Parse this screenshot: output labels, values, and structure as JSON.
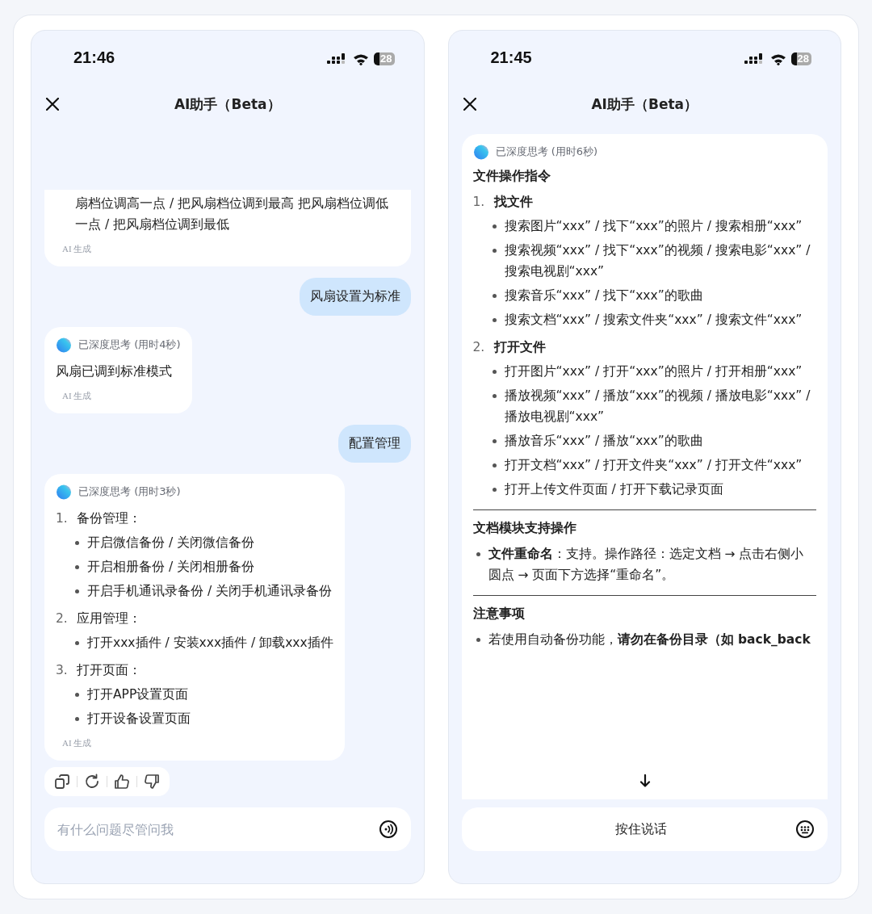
{
  "panels": [
    {
      "status": {
        "time": "21:46",
        "battery": "28"
      },
      "title": "AI助手（Beta）",
      "scrolled_to_end": true,
      "messages": [
        {
          "kind": "ai",
          "cut_top": true,
          "cut_bottom": false,
          "blocks": [
            {
              "kind": "continuation",
              "text": "扇档位调高一点 / 把风扇档位调到最高 把风扇档位调低一点 / 把风扇档位调到最低"
            }
          ],
          "footer": "AI 生成"
        },
        {
          "kind": "user",
          "text": "风扇设置为标准"
        },
        {
          "kind": "ai",
          "cut_top": false,
          "cut_bottom": false,
          "thinking": "已深度思考 (用时4秒)",
          "blocks": [
            {
              "kind": "paragraph",
              "text": "风扇已调到标准模式"
            }
          ],
          "footer": "AI 生成"
        },
        {
          "kind": "user",
          "text": "配置管理"
        },
        {
          "kind": "ai",
          "cut_top": false,
          "cut_bottom": false,
          "thinking": "已深度思考 (用时3秒)",
          "blocks": [
            {
              "kind": "ordered",
              "bold_titles": false,
              "items": [
                {
                  "number": "1.",
                  "title": "备份管理：",
                  "bullets": [
                    "开启微信备份 / 关闭微信备份",
                    "开启相册备份 / 关闭相册备份",
                    "开启手机通讯录备份 / 关闭手机通讯录备份"
                  ]
                },
                {
                  "number": "2.",
                  "title": "应用管理：",
                  "bullets": [
                    "打开xxx插件 / 安装xxx插件 / 卸载xxx插件"
                  ]
                },
                {
                  "number": "3.",
                  "title": "打开页面：",
                  "bullets": [
                    "打开APP设置页面",
                    "打开设备设置页面"
                  ]
                }
              ]
            }
          ],
          "footer": "AI 生成",
          "actions": true
        }
      ],
      "composer": {
        "kind": "text",
        "placeholder": "有什么问题尽管问我"
      },
      "scroll_down": false
    },
    {
      "status": {
        "time": "21:45",
        "battery": "28"
      },
      "title": "AI助手（Beta）",
      "scrolled_to_end": false,
      "messages": [
        {
          "kind": "ai",
          "cut_top": false,
          "cut_bottom": true,
          "thinking": "已深度思考 (用时6秒)",
          "blocks": [
            {
              "kind": "heading",
              "text": "文件操作指令"
            },
            {
              "kind": "ordered",
              "bold_titles": true,
              "items": [
                {
                  "number": "1.",
                  "title": "找文件",
                  "bullets": [
                    "搜索图片“xxx” / 找下“xxx”的照片 / 搜索相册“xxx”",
                    "搜索视频“xxx” / 找下“xxx”的视频 / 搜索电影“xxx” / 搜索电视剧“xxx”",
                    "搜索音乐“xxx” / 找下“xxx”的歌曲",
                    "搜索文档“xxx” / 搜索文件夹“xxx” / 搜索文件“xxx”"
                  ]
                },
                {
                  "number": "2.",
                  "title": "打开文件",
                  "bullets": [
                    "打开图片“xxx” / 打开“xxx”的照片 / 打开相册“xxx”",
                    "播放视频“xxx” / 播放“xxx”的视频 / 播放电影“xxx” / 播放电视剧“xxx”",
                    "播放音乐“xxx” / 播放“xxx”的歌曲",
                    "打开文档“xxx” / 打开文件夹“xxx” / 打开文件“xxx”",
                    "打开上传文件页面 / 打开下载记录页面"
                  ]
                }
              ]
            },
            {
              "kind": "rule"
            },
            {
              "kind": "heading",
              "text": "文档模块支持操作"
            },
            {
              "kind": "bullets",
              "items": [
                "**文件重命名**：支持。操作路径：选定文档 → 点击右侧小圆点 → 页面下方选择“重命名”。"
              ]
            },
            {
              "kind": "rule"
            },
            {
              "kind": "heading",
              "text": "注意事项"
            },
            {
              "kind": "bullets",
              "items": [
                "若使用自动备份功能，**请勿在备份目录（如 back_back**"
              ]
            }
          ]
        }
      ],
      "composer": {
        "kind": "voice",
        "label": "按住说话"
      },
      "scroll_down": true
    }
  ]
}
